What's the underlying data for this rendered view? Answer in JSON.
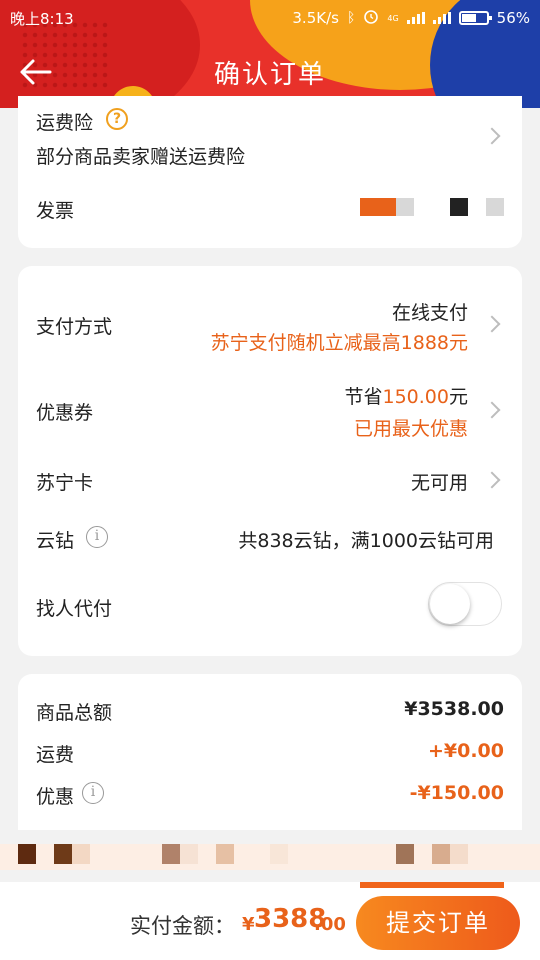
{
  "status_bar": {
    "time": "晚上8:13",
    "net_speed": "3.5K/s",
    "network_tag": "4G",
    "battery": "56%"
  },
  "nav": {
    "title": "确认订单"
  },
  "card1": {
    "shipping_insurance_label": "运费险",
    "shipping_insurance_desc": "部分商品卖家赠送运费险",
    "invoice_label": "发票"
  },
  "card2": {
    "payment_label": "支付方式",
    "payment_value": "在线支付",
    "payment_promo": "苏宁支付随机立减最高1888元",
    "coupon_label": "优惠券",
    "coupon_save_prefix": "节省",
    "coupon_save_amount": "150.00",
    "coupon_save_suffix": "元",
    "coupon_status": "已用最大优惠",
    "suning_card_label": "苏宁卡",
    "suning_card_value": "无可用",
    "yunzuan_label": "云钻",
    "yunzuan_value": "共838云钻，满1000云钻可用",
    "pay_by_other_label": "找人代付",
    "pay_by_other_enabled": false
  },
  "card3": {
    "goods_total_label": "商品总额",
    "goods_total_value": "¥3538.00",
    "shipping_label": "运费",
    "shipping_value": "+¥0.00",
    "discount_label": "优惠",
    "discount_value": "-¥150.00"
  },
  "bottom": {
    "total_label": "实付金额：",
    "total_currency": "¥",
    "total_integer": "3388",
    "total_decimal": ".00",
    "submit_label": "提交订单"
  },
  "colors": {
    "accent_orange": "#e8621a",
    "header_red": "#e8312a",
    "header_yellow": "#f6a21a",
    "header_blue": "#1e3fa8"
  }
}
